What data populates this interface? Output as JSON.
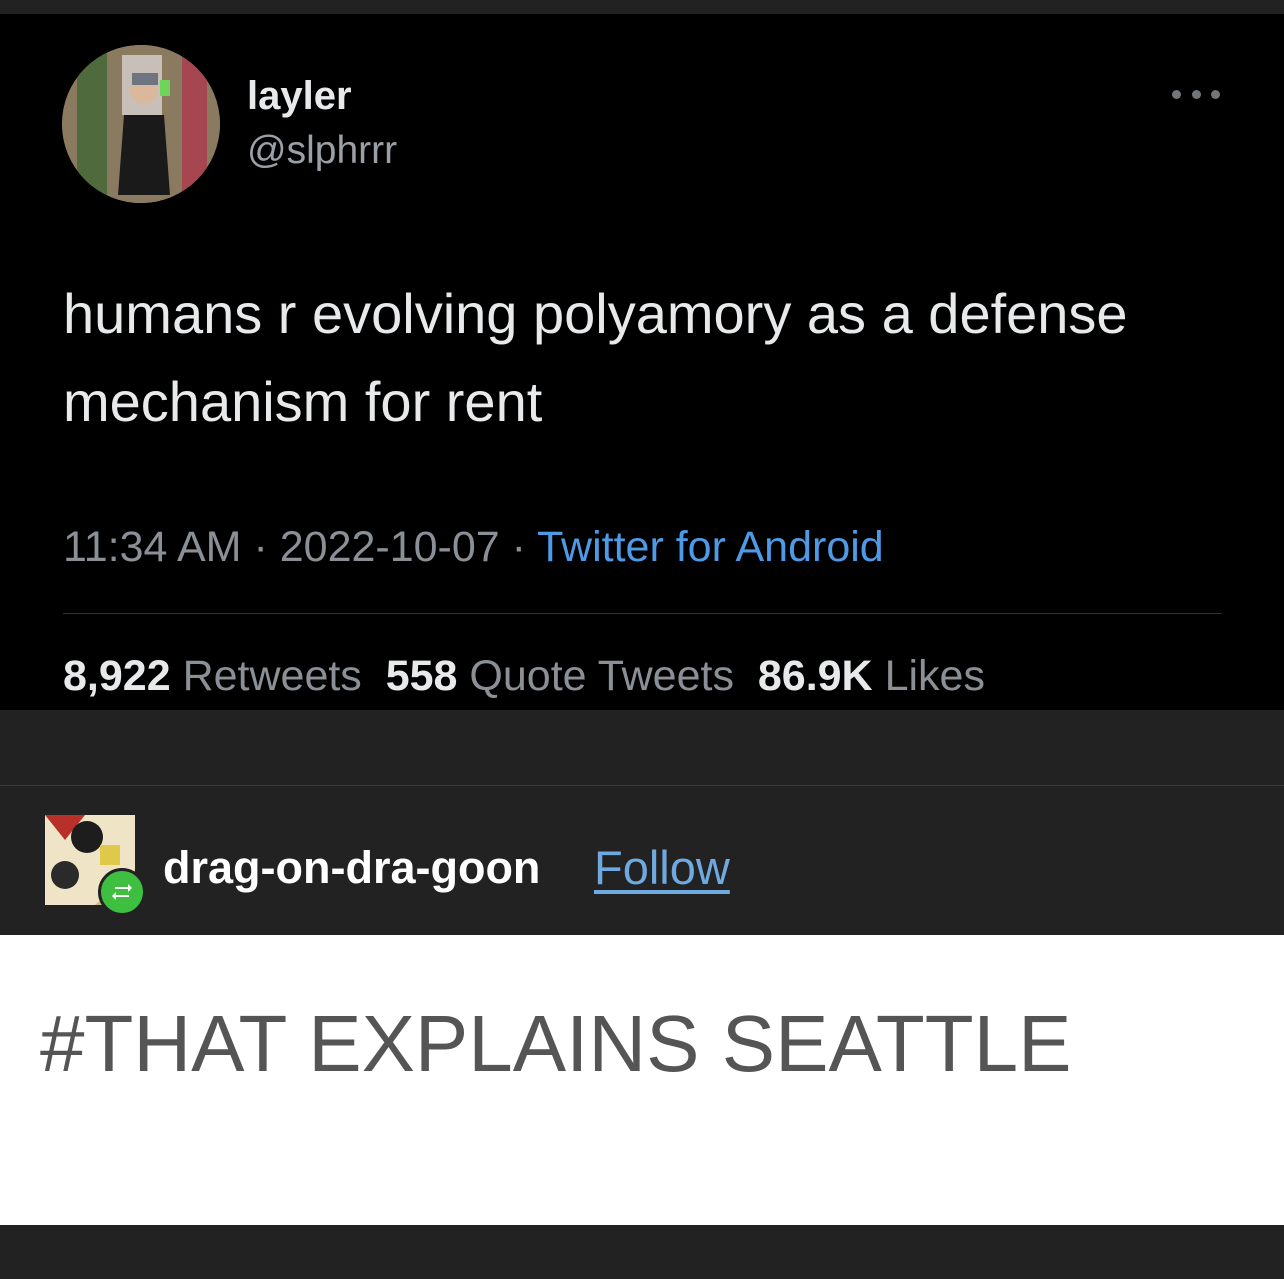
{
  "tweet": {
    "display_name": "layler",
    "handle": "@slphrrr",
    "text": "humans r evolving polyamory as a defense mechanism for rent",
    "time": "11:34 AM",
    "separator": "·",
    "date": "2022-10-07",
    "source": "Twitter for Android",
    "stats": {
      "retweets_count": "8,922",
      "retweets_label": "Retweets",
      "quotes_count": "558",
      "quotes_label": "Quote Tweets",
      "likes_count": "86.9K",
      "likes_label": "Likes"
    }
  },
  "post": {
    "blog_name": "drag-on-dra-goon",
    "follow_label": "Follow",
    "tag_text": "#THAT EXPLAINS SEATTLE"
  },
  "colors": {
    "tweet_bg": "#000000",
    "page_bg": "#222222",
    "link_blue": "#4e9ae6",
    "reblog_green": "#3fbf3f"
  }
}
